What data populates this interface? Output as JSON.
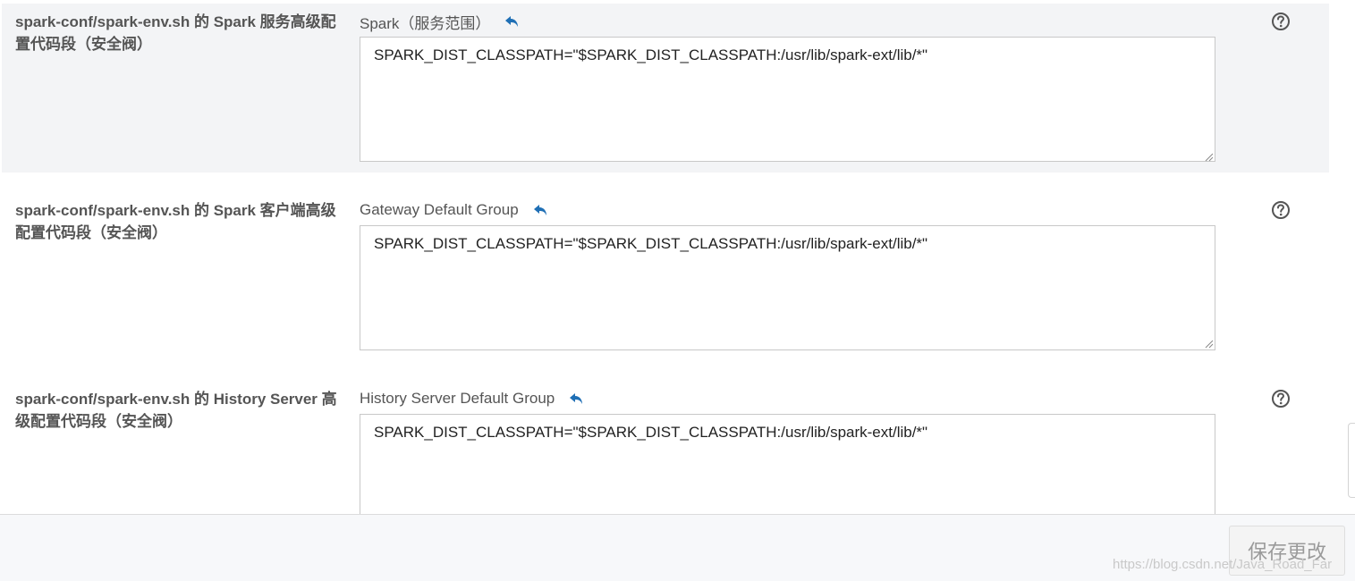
{
  "colors": {
    "accent": "#1f6fb5",
    "highlight_row_bg": "#f3f4f6",
    "label_text": "#555555",
    "footer_bg": "#f7f8fa",
    "save_disabled_text": "#9a9a9a"
  },
  "settings": [
    {
      "label": "spark-conf/spark-env.sh 的 Spark 服务高级配置代码段（安全阀）",
      "scope": "Spark（服务范围）",
      "value": "SPARK_DIST_CLASSPATH=\"$SPARK_DIST_CLASSPATH:/usr/lib/spark-ext/lib/*\"",
      "revert_icon": "undo-arrow-icon",
      "help_icon": "question-circle-icon"
    },
    {
      "label": "spark-conf/spark-env.sh 的 Spark 客户端高级配置代码段（安全阀）",
      "scope": "Gateway Default Group",
      "value": "SPARK_DIST_CLASSPATH=\"$SPARK_DIST_CLASSPATH:/usr/lib/spark-ext/lib/*\"",
      "revert_icon": "undo-arrow-icon",
      "help_icon": "question-circle-icon"
    },
    {
      "label": "spark-conf/spark-env.sh 的 History Server 高级配置代码段（安全阀）",
      "scope": "History Server Default Group",
      "value": "SPARK_DIST_CLASSPATH=\"$SPARK_DIST_CLASSPATH:/usr/lib/spark-ext/lib/*\"",
      "revert_icon": "undo-arrow-icon",
      "help_icon": "question-circle-icon"
    }
  ],
  "footer": {
    "save_label": "保存更改",
    "watermark": "https://blog.csdn.net/Java_Road_Far"
  }
}
